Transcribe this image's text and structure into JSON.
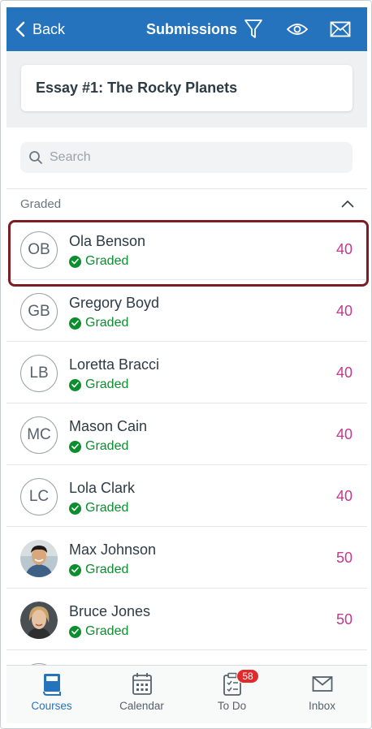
{
  "header": {
    "back_label": "Back",
    "title": "Submissions",
    "icons": [
      "filter-icon",
      "eye-icon",
      "mail-icon"
    ],
    "color": "#2573bc"
  },
  "assignment": {
    "title": "Essay #1: The Rocky Planets"
  },
  "search": {
    "placeholder": "Search",
    "value": ""
  },
  "section": {
    "label": "Graded",
    "collapse_icon": "chevron-up-icon"
  },
  "students": [
    {
      "initials": "OB",
      "name": "Ola Benson",
      "status": "Graded",
      "score": "40",
      "selected": true
    },
    {
      "initials": "GB",
      "name": "Gregory Boyd",
      "status": "Graded",
      "score": "40"
    },
    {
      "initials": "LB",
      "name": "Loretta Bracci",
      "status": "Graded",
      "score": "40"
    },
    {
      "initials": "MC",
      "name": "Mason Cain",
      "status": "Graded",
      "score": "40"
    },
    {
      "initials": "LC",
      "name": "Lola Clark",
      "status": "Graded",
      "score": "40"
    },
    {
      "initials": "",
      "name": "Max Johnson",
      "status": "Graded",
      "score": "50",
      "photo": "avatar-photo-icon"
    },
    {
      "initials": "",
      "name": "Bruce Jones",
      "status": "Graded",
      "score": "50",
      "photo": "avatar-photo-icon"
    }
  ],
  "tabs": [
    {
      "label": "Courses",
      "icon": "book-icon",
      "active": true
    },
    {
      "label": "Calendar",
      "icon": "calendar-icon"
    },
    {
      "label": "To Do",
      "icon": "clipboard-icon",
      "badge": "58"
    },
    {
      "label": "Inbox",
      "icon": "inbox-icon"
    }
  ],
  "colors": {
    "graded_green": "#0b8e2d",
    "score_pink": "#c33a8f",
    "selection_border": "#7a1e23",
    "badge_red": "#e12a2a"
  }
}
